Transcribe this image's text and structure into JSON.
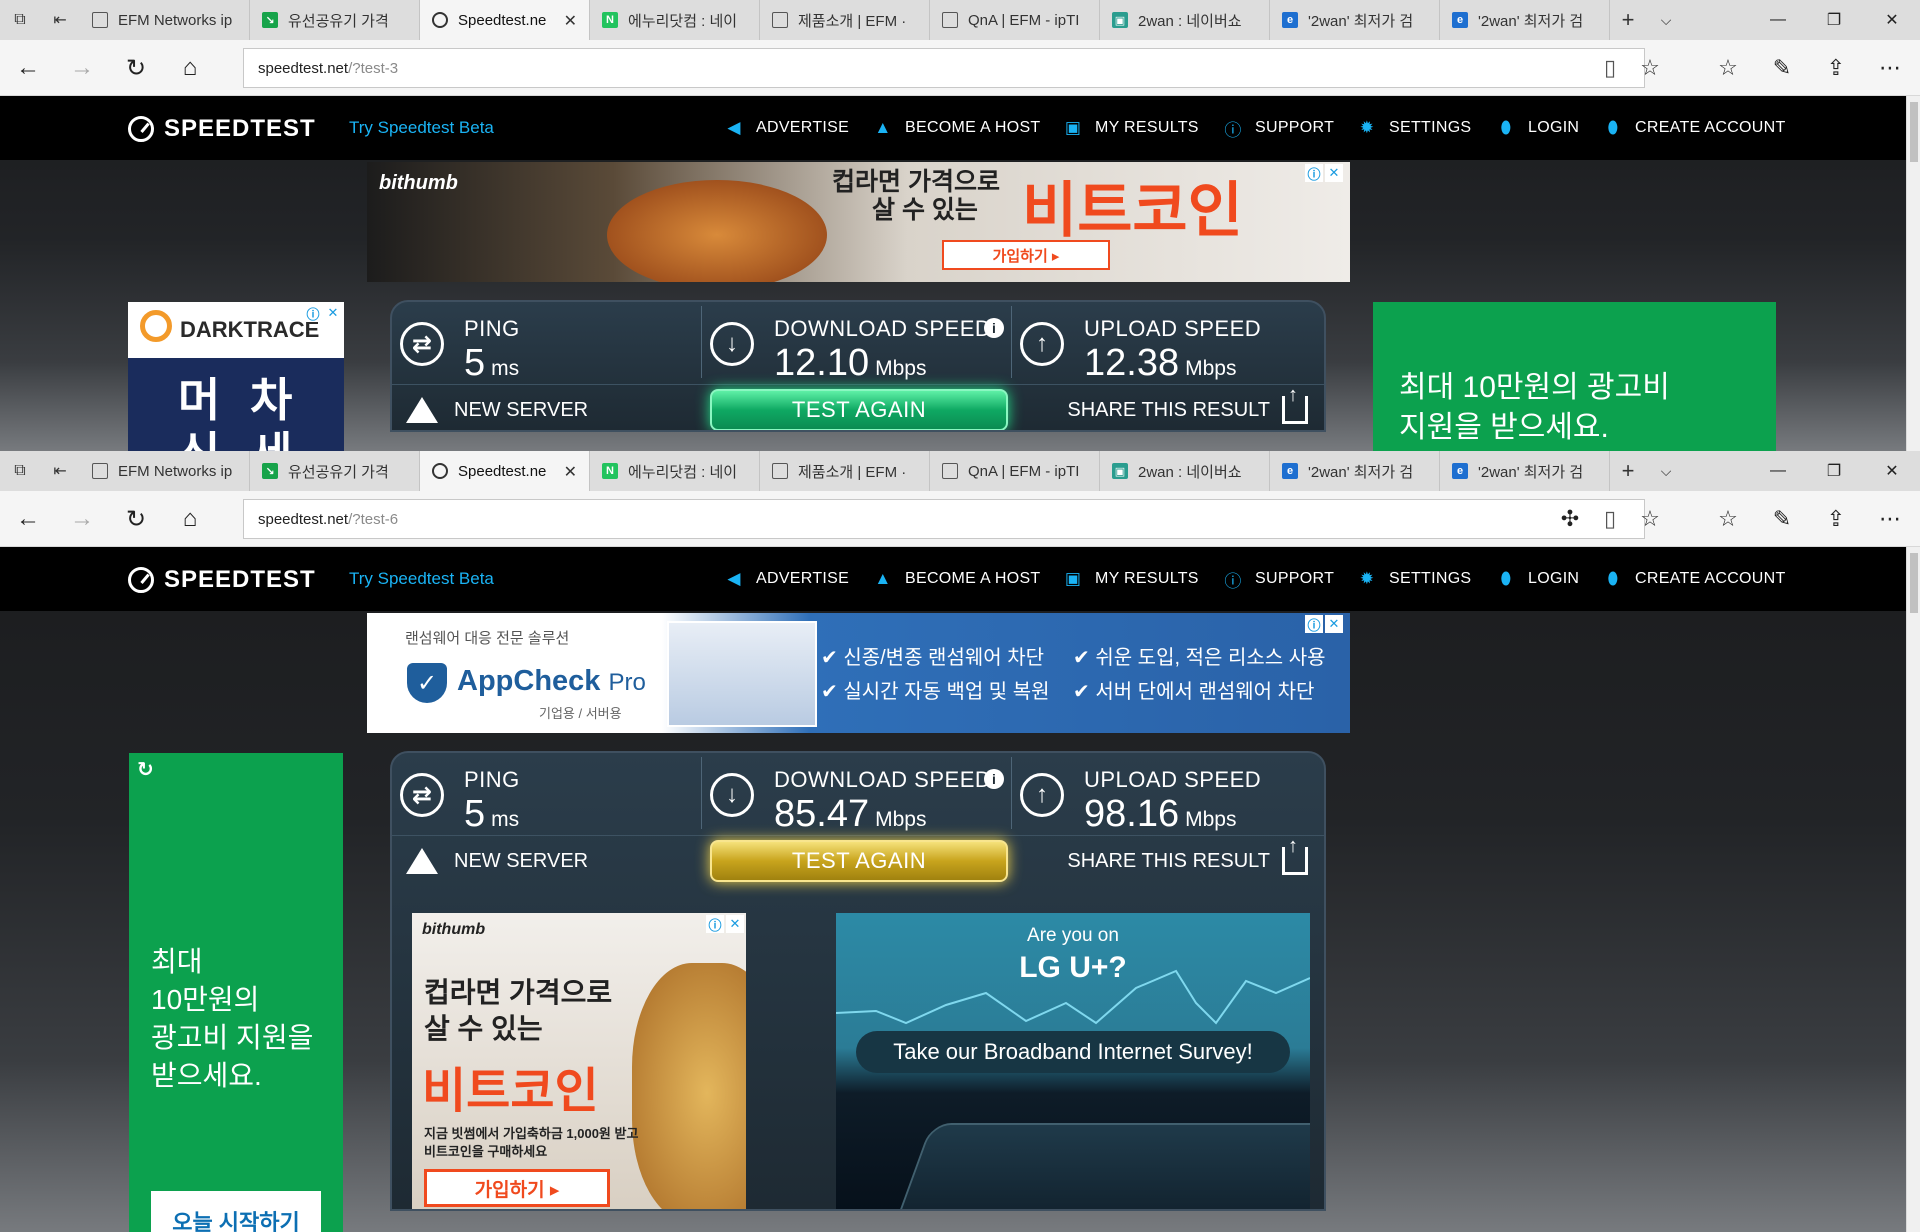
{
  "tabs": [
    {
      "label": "EFM Networks ip",
      "icon": "page-icon",
      "color": "#ffffff"
    },
    {
      "label": "유선공유기 가격",
      "icon": "naver-shopping-icon",
      "color": "#17a34a"
    },
    {
      "label": "Speedtest.ne",
      "icon": "speedtest-icon",
      "color": "#ffffff",
      "active": true
    },
    {
      "label": "에누리닷컴 : 네이",
      "icon": "naver-icon",
      "color": "#22c35e"
    },
    {
      "label": "제품소개 | EFM ·",
      "icon": "page-icon",
      "color": "#ffffff"
    },
    {
      "label": "QnA | EFM - ipTI",
      "icon": "page-icon",
      "color": "#ffffff"
    },
    {
      "label": "2wan : 네이버쇼",
      "icon": "naver-shop-icon",
      "color": "#2a9d8f"
    },
    {
      "label": "'2wan' 최저가 검",
      "icon": "enuri-icon",
      "color": "#1e6fd0"
    },
    {
      "label": "'2wan' 최저가 검",
      "icon": "enuri-icon",
      "color": "#1e6fd0"
    }
  ],
  "window1": {
    "url_host": "speedtest.net",
    "url_path": "/?test-3",
    "ping": {
      "label": "PING",
      "value": "5",
      "unit": "ms"
    },
    "download": {
      "label": "DOWNLOAD SPEED",
      "value": "12.10",
      "unit": "Mbps"
    },
    "upload": {
      "label": "UPLOAD SPEED",
      "value": "12.38",
      "unit": "Mbps"
    },
    "top_ad": {
      "brand": "bithumb",
      "headline1": "컵라면 가격으로",
      "headline2": "살 수 있는",
      "headline3": "비트코인",
      "cta": "가입하기 ▸"
    },
    "left_ad": {
      "brand": "DARKTRACE",
      "text1": "머",
      "text2": "차",
      "text3": "신",
      "text4": "세"
    },
    "right_ad": {
      "line1": "최대 10만원의 광고비",
      "line2": "지원을 받으세요."
    }
  },
  "window2": {
    "url_host": "speedtest.net",
    "url_path": "/?test-6",
    "ping": {
      "label": "PING",
      "value": "5",
      "unit": "ms"
    },
    "download": {
      "label": "DOWNLOAD SPEED",
      "value": "85.47",
      "unit": "Mbps"
    },
    "upload": {
      "label": "UPLOAD SPEED",
      "value": "98.16",
      "unit": "Mbps"
    },
    "top_ad": {
      "tag": "랜섬웨어 대응 전문 솔루션",
      "brand": "AppCheck",
      "brand_suffix": "Pro",
      "sub": "기업용 / 서버용",
      "f1": "신종/변종 랜섬웨어 차단",
      "f2": "쉬운 도입, 적은 리소스 사용",
      "f3": "실시간 자동 백업 및 복원",
      "f4": "서버 단에서 랜섬웨어 차단"
    },
    "left_ad": {
      "line1": "최대",
      "line2": "10만원의",
      "line3": "광고비 지원을",
      "line4": "받으세요.",
      "cta": "오늘 시작하기"
    },
    "lower_ad": {
      "brand": "bithumb",
      "headline1": "컵라면 가격으로",
      "headline2": "살 수 있는",
      "headline3": "비트코인",
      "fine1": "지금 빗썸에서 가입축하금 1,000원 받고",
      "fine2": "비트코인을 구매하세요",
      "cta": "가입하기 ▸"
    },
    "survey": {
      "q1": "Are you on",
      "q2": "LG U+?",
      "cta": "Take our Broadband Internet Survey!"
    }
  },
  "nav": {
    "logo": "SPEEDTEST",
    "beta": "Try Speedtest Beta",
    "advertise": "ADVERTISE",
    "become_host": "BECOME A HOST",
    "my_results": "MY RESULTS",
    "support": "SUPPORT",
    "settings": "SETTINGS",
    "login": "LOGIN",
    "create_account": "CREATE ACCOUNT"
  },
  "panel": {
    "new_server": "NEW SERVER",
    "test_again": "TEST AGAIN",
    "share": "SHARE THIS RESULT"
  },
  "colors": {
    "accent": "#1ab3f4",
    "green_button": "#0fa963",
    "yellow_button": "#c8a41d",
    "green_ad": "#0ca14e"
  }
}
